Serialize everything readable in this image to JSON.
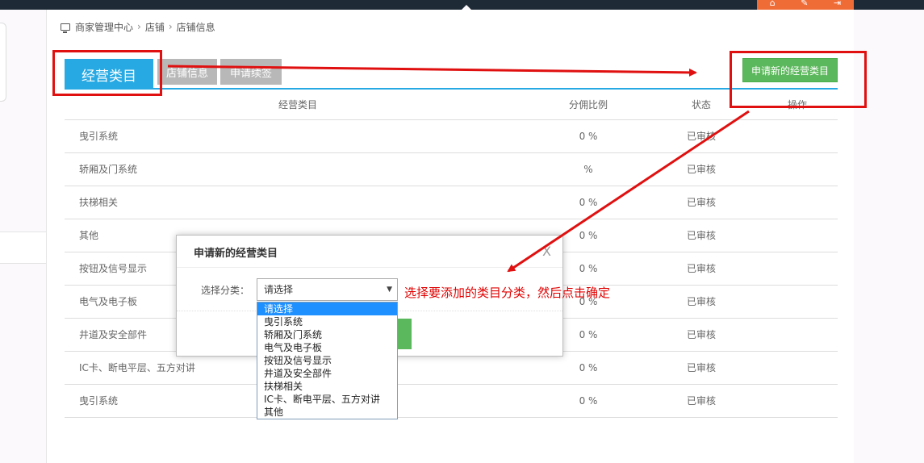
{
  "topbar": {
    "icons": [
      "home-icon",
      "wrench-icon",
      "logout-icon"
    ]
  },
  "breadcrumb": [
    "商家管理中心",
    "店铺",
    "店铺信息"
  ],
  "tabs": [
    {
      "label": "经营类目",
      "active": true
    },
    {
      "label": "店铺信息",
      "active": false
    },
    {
      "label": "申请续签",
      "active": false
    }
  ],
  "apply_button": "申请新的经营类目",
  "table": {
    "headers": [
      "经营类目",
      "分佣比例",
      "状态",
      "操作"
    ],
    "rows": [
      {
        "name": "曳引系统",
        "rate": "0 %",
        "status": "已审核"
      },
      {
        "name": "轿厢及门系统",
        "rate": "%",
        "status": "已审核"
      },
      {
        "name": "扶梯相关",
        "rate": "0 %",
        "status": "已审核"
      },
      {
        "name": "其他",
        "rate": "0 %",
        "status": "已审核"
      },
      {
        "name": "按钮及信号显示",
        "rate": "0 %",
        "status": "已审核"
      },
      {
        "name": "电气及电子板",
        "rate": "0 %",
        "status": "已审核"
      },
      {
        "name": "井道及安全部件",
        "rate": "0 %",
        "status": "已审核"
      },
      {
        "name": "IC卡、断电平层、五方对讲",
        "rate": "0 %",
        "status": "已审核"
      },
      {
        "name": "曳引系统",
        "rate": "0 %",
        "status": "已审核"
      }
    ]
  },
  "modal": {
    "title": "申请新的经营类目",
    "close": "X",
    "label": "选择分类：",
    "select_value": "请选择",
    "options": [
      "请选择",
      "曳引系统",
      "轿厢及门系统",
      "电气及电子板",
      "按钮及信号显示",
      "井道及安全部件",
      "扶梯相关",
      "IC卡、断电平层、五方对讲",
      "其他"
    ]
  },
  "annotation": "选择要添加的类目分类，然后点击确定",
  "colors": {
    "accent": "#27a9e3",
    "success": "#5cb85c",
    "annotation": "#e01010",
    "topbar": "#1e2a36",
    "top_icons_bg": "#ef6c37"
  }
}
